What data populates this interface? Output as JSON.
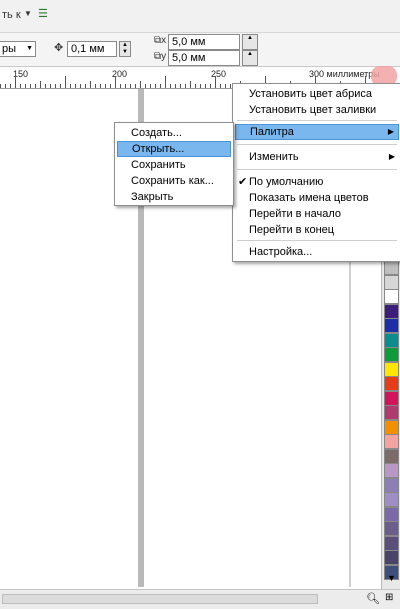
{
  "toolbar": {
    "fragment_label": "ть к",
    "dropdown_fragment": "ры",
    "nudge_value": "0,1 мм",
    "dup_x_value": "5,0 мм",
    "dup_y_value": "5,0 мм"
  },
  "ruler": {
    "labels": [
      "150",
      "200",
      "250",
      "300 миллиметры"
    ]
  },
  "palette_menu": {
    "items": [
      {
        "label": "Установить цвет абриса"
      },
      {
        "label": "Установить цвет заливки"
      },
      {
        "label": "Палитра",
        "highlighted": true,
        "submenu": true
      },
      {
        "label": "Изменить",
        "submenu": true
      },
      {
        "label": "По умолчанию",
        "checked": true
      },
      {
        "label": "Показать имена цветов"
      },
      {
        "label": "Перейти в начало"
      },
      {
        "label": "Перейти в конец"
      },
      {
        "label": "Настройка..."
      }
    ]
  },
  "submenu": {
    "items": [
      {
        "label": "Создать..."
      },
      {
        "label": "Открыть...",
        "highlighted": true
      },
      {
        "label": "Сохранить"
      },
      {
        "label": "Сохранить как..."
      },
      {
        "label": "Закрыть"
      }
    ]
  },
  "palette_swatches": [
    "#2d2d2d",
    "#474747",
    "#5e5e5e",
    "#767676",
    "#8d8d8d",
    "#a5a5a5",
    "#bebebe",
    "#d6d6d6",
    "#ffffff",
    "#3b1d7a",
    "#1c2fa8",
    "#0a8d8d",
    "#0e9b3a",
    "#ffe600",
    "#e63d16",
    "#d4145a",
    "#b03a6e",
    "#f29100",
    "#f4a3a0",
    "#7d6b6b",
    "#b897c4",
    "#8c7fb5",
    "#9d8fc6",
    "#7b6aa8",
    "#6a5f8c",
    "#5a4e7a",
    "#4a4468",
    "#3d4f7a"
  ],
  "colors": {
    "highlight": "#79b7ee",
    "menu_bg": "#ffffff"
  }
}
